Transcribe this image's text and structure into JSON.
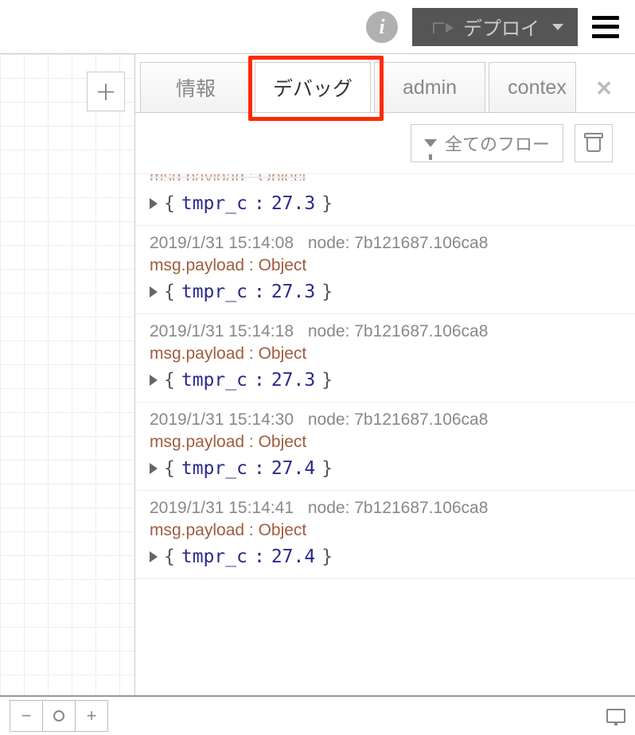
{
  "header": {
    "deploy_label": "デプロイ"
  },
  "tabs": [
    {
      "label": "情報",
      "active": false
    },
    {
      "label": "デバッグ",
      "active": true
    },
    {
      "label": "admin",
      "active": false
    },
    {
      "label": "contex",
      "active": false
    }
  ],
  "filter": {
    "label": "全てのフロー"
  },
  "log_entries": [
    {
      "cutoff_top": true,
      "payload": "msg.payload : Object",
      "key": "tmpr_c",
      "value": "27.3"
    },
    {
      "time": "2019/1/31 15:14:08",
      "node": "node: 7b121687.106ca8",
      "payload": "msg.payload : Object",
      "key": "tmpr_c",
      "value": "27.3"
    },
    {
      "time": "2019/1/31 15:14:18",
      "node": "node: 7b121687.106ca8",
      "payload": "msg.payload : Object",
      "key": "tmpr_c",
      "value": "27.3"
    },
    {
      "time": "2019/1/31 15:14:30",
      "node": "node: 7b121687.106ca8",
      "payload": "msg.payload : Object",
      "key": "tmpr_c",
      "value": "27.4"
    },
    {
      "time": "2019/1/31 15:14:41",
      "node": "node: 7b121687.106ca8",
      "payload": "msg.payload : Object",
      "key": "tmpr_c",
      "value": "27.4"
    }
  ]
}
